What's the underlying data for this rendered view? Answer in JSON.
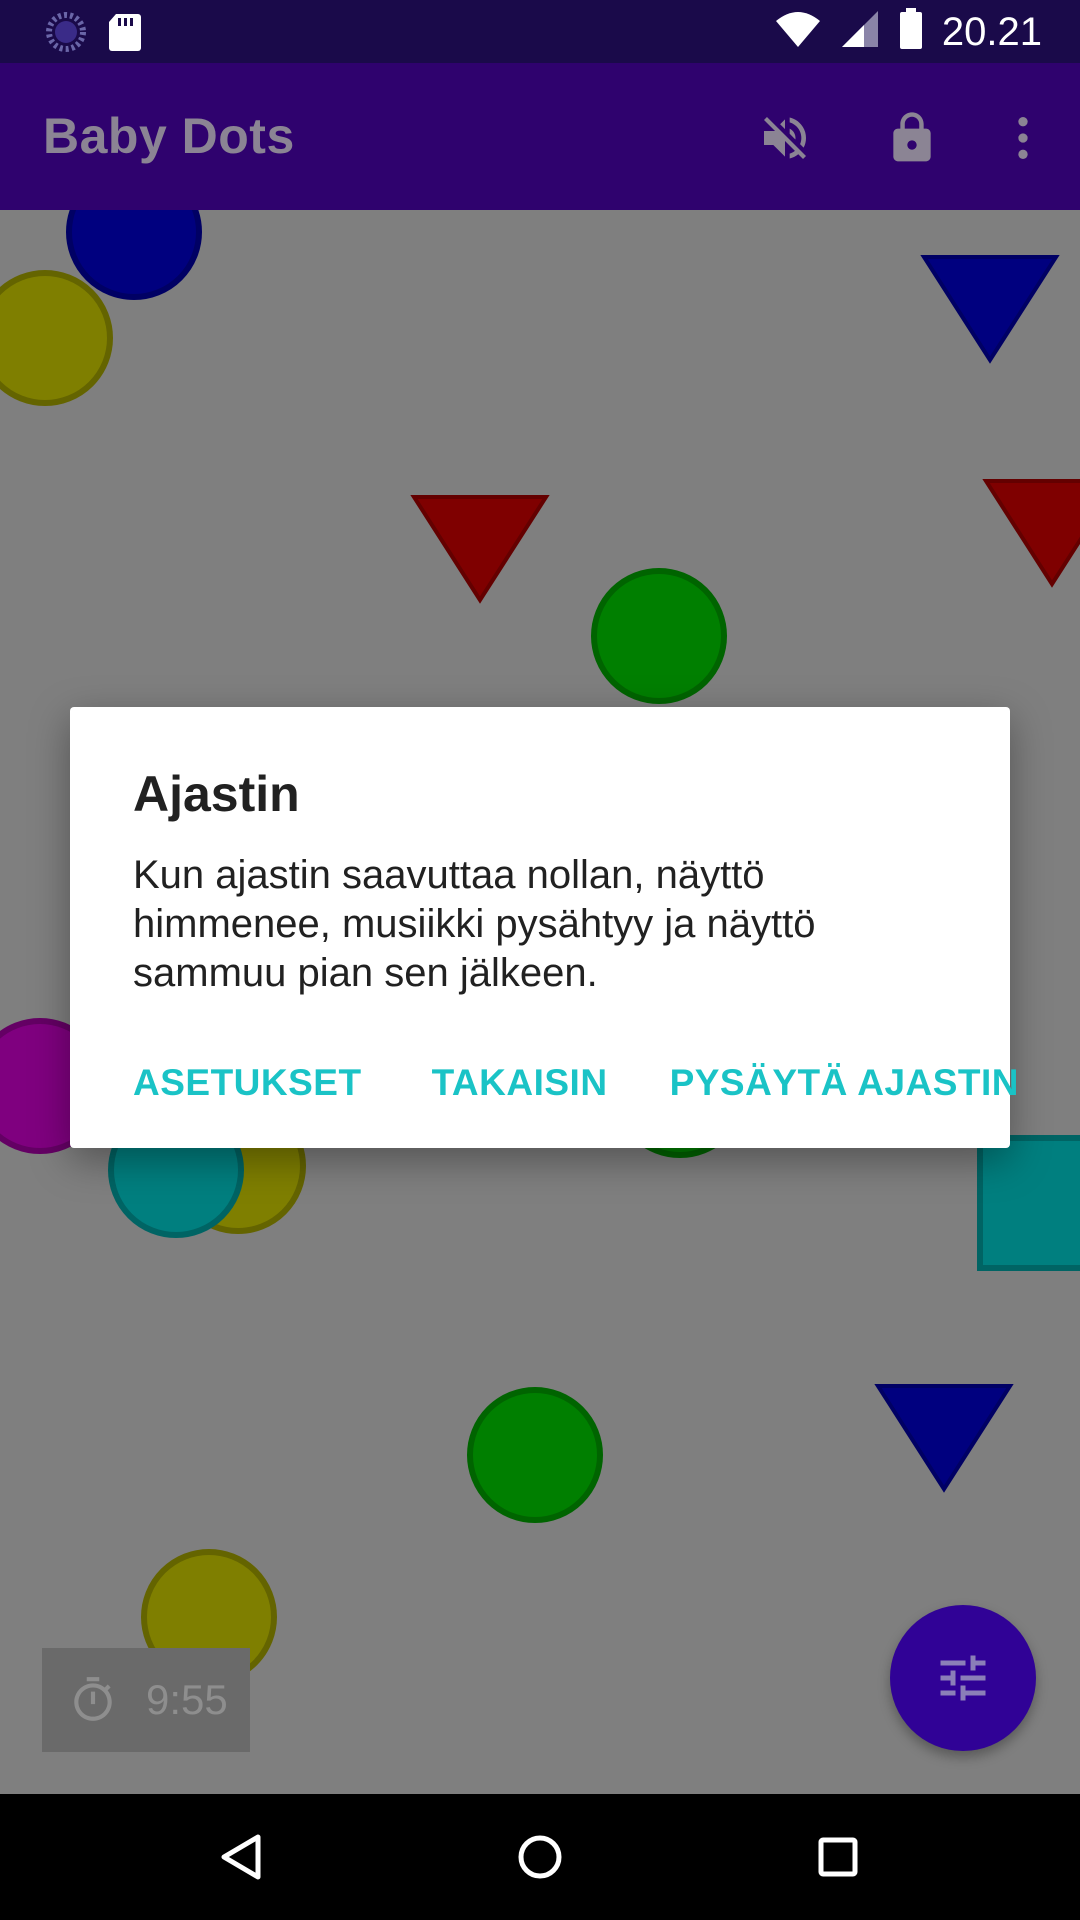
{
  "status_bar": {
    "time": "20.21",
    "icons": [
      "loading-icon",
      "sd-card-icon",
      "wifi-icon",
      "signal-icon",
      "battery-icon"
    ]
  },
  "app_bar": {
    "title": "Baby Dots",
    "actions": [
      "mute-icon",
      "lock-icon",
      "more-vert-icon"
    ]
  },
  "timer": {
    "value": "9:55",
    "icon": "timer-icon"
  },
  "fab": {
    "icon": "tune-icon"
  },
  "dialog": {
    "title": "Ajastin",
    "message": "Kun ajastin saavuttaa nollan, näyttö himmenee, musiikki pysähtyy ja näyttö sammuu pian sen jälkeen.",
    "buttons": {
      "settings": "ASETUKSET",
      "back": "TAKAISIN",
      "stop": "PYSÄYTÄ AJASTIN"
    }
  },
  "colors": {
    "accent": "#1ac3c6",
    "app_bar": "#2f026e",
    "status_bar": "#1a0a4a",
    "fab": "#300296",
    "canvas_dim": "#7f7f7f"
  },
  "navbar": [
    "back-icon",
    "home-icon",
    "recents-icon"
  ]
}
